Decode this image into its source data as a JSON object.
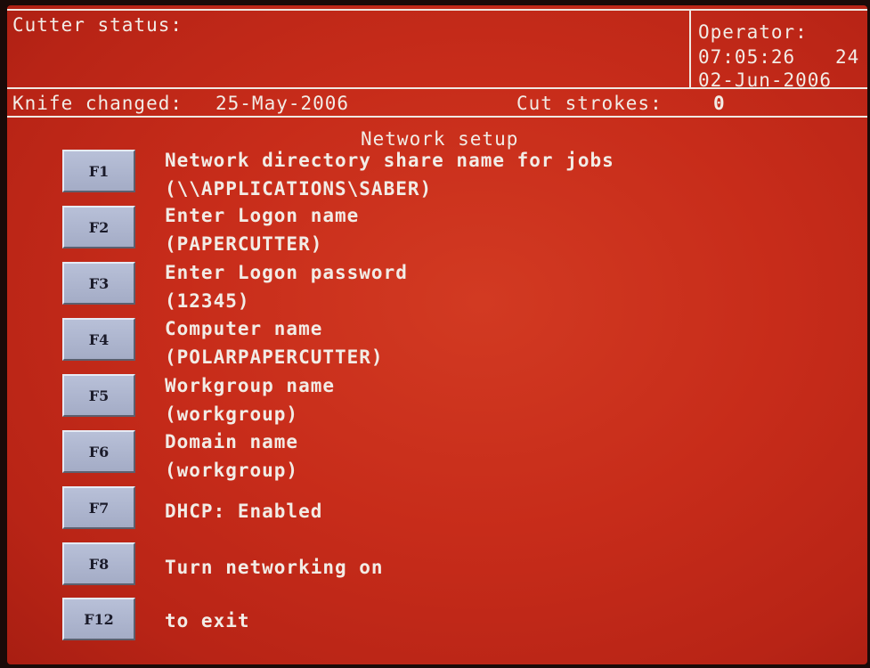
{
  "header": {
    "cutter_status_label": "Cutter status:",
    "operator_label": "Operator:",
    "time": "07:05:26",
    "operator_value": "24",
    "date": "02-Jun-2006",
    "knife_changed_label": "Knife changed:",
    "knife_changed_date": "25-May-2006",
    "cut_strokes_label": "Cut strokes:",
    "cut_strokes_value": "0"
  },
  "title": "Network setup",
  "options": [
    {
      "key": "F1",
      "line1": "Network directory share name for jobs",
      "line2": "(\\\\APPLICATIONS\\SABER)"
    },
    {
      "key": "F2",
      "line1": "Enter Logon name",
      "line2": "(PAPERCUTTER)"
    },
    {
      "key": "F3",
      "line1": "Enter Logon password",
      "line2": "(12345)"
    },
    {
      "key": "F4",
      "line1": "Computer name",
      "line2": "(POLARPAPERCUTTER)"
    },
    {
      "key": "F5",
      "line1": "Workgroup name",
      "line2": "(workgroup)"
    },
    {
      "key": "F6",
      "line1": "Domain name",
      "line2": "(workgroup)"
    },
    {
      "key": "F7",
      "line1": "DHCP: Enabled"
    },
    {
      "key": "F8",
      "line1": "Turn networking on"
    },
    {
      "key": "F12",
      "line1": "to exit"
    }
  ],
  "colors": {
    "background": "#c72c1a",
    "text": "#f2ece6",
    "key_face": "#b0b8d0"
  }
}
